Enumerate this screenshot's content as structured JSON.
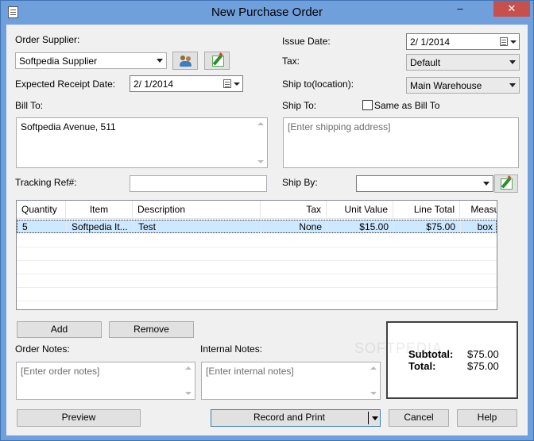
{
  "window": {
    "title": "New Purchase Order",
    "minimize_label": "–",
    "close_label": "✕"
  },
  "form": {
    "order_supplier_label": "Order Supplier:",
    "order_supplier_value": "Softpedia Supplier",
    "expected_receipt_label": "Expected Receipt Date:",
    "expected_receipt_value": "2/  1/2014",
    "bill_to_label": "Bill To:",
    "bill_to_value": "Softpedia Avenue, 511",
    "tracking_ref_label": "Tracking Ref#:",
    "tracking_ref_value": "",
    "issue_date_label": "Issue Date:",
    "issue_date_value": "2/  1/2014",
    "tax_label": "Tax:",
    "tax_value": "Default",
    "ship_to_location_label": "Ship to(location):",
    "ship_to_location_value": "Main Warehouse",
    "ship_to_label": "Ship To:",
    "same_as_bill_to_label": "Same as Bill To",
    "same_as_bill_to_checked": false,
    "ship_to_placeholder": "[Enter shipping address]",
    "ship_by_label": "Ship By:",
    "ship_by_value": ""
  },
  "grid": {
    "columns": [
      "Quantity",
      "Item",
      "Description",
      "Tax",
      "Unit Value",
      "Line Total",
      "Measure"
    ],
    "rows": [
      {
        "quantity": "5",
        "item": "Softpedia It...",
        "description": "Test",
        "tax": "None",
        "unit_value": "$15.00",
        "line_total": "$75.00",
        "measure": "box"
      }
    ]
  },
  "actions": {
    "add_label": "Add",
    "remove_label": "Remove"
  },
  "notes": {
    "order_notes_label": "Order Notes:",
    "order_notes_placeholder": "[Enter order notes]",
    "internal_notes_label": "Internal Notes:",
    "internal_notes_placeholder": "[Enter internal notes]"
  },
  "totals": {
    "subtotal_label": "Subtotal:",
    "subtotal_value": "$75.00",
    "total_label": "Total:",
    "total_value": "$75.00",
    "watermark": "SOFTPEDIA"
  },
  "footer": {
    "preview_label": "Preview",
    "record_print_label": "Record and Print",
    "cancel_label": "Cancel",
    "help_label": "Help"
  },
  "colors": {
    "titlebar": "#6fa0dc",
    "close": "#c7504c",
    "selection": "#cde8ff"
  }
}
